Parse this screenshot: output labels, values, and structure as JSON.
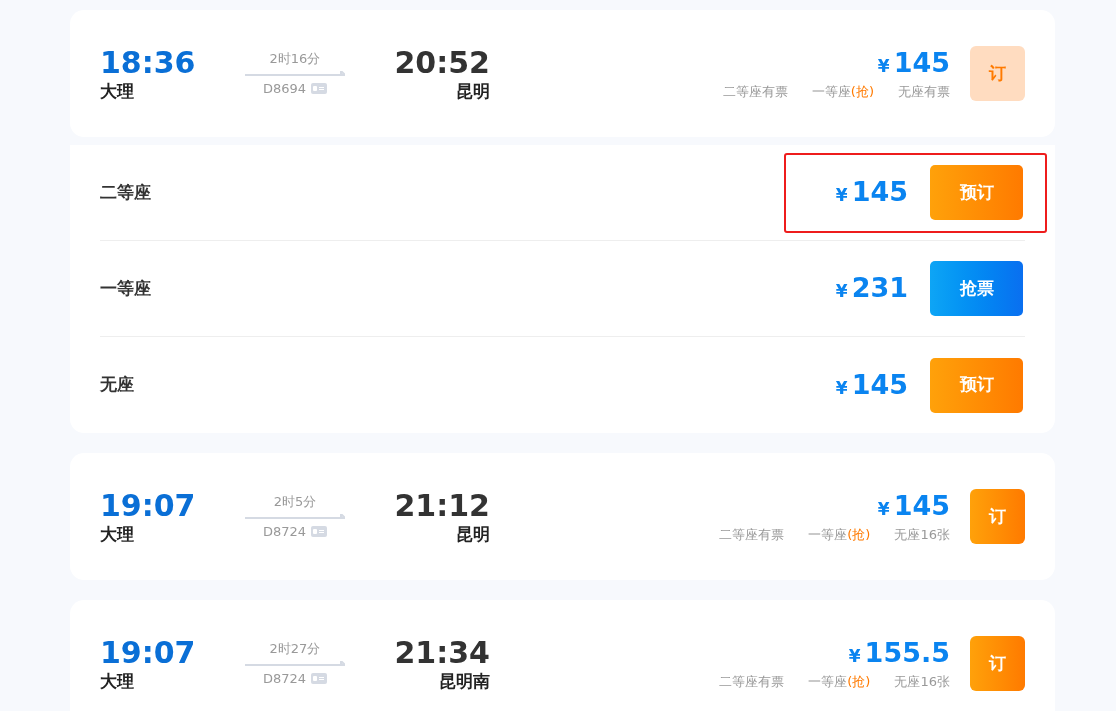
{
  "trains": [
    {
      "depart_time": "18:36",
      "depart_station": "大理",
      "duration": "2时16分",
      "train_no": "D8694",
      "arrive_time": "20:52",
      "arrive_station": "昆明",
      "price_symbol": "¥",
      "price": "145",
      "availability": [
        {
          "label": "二等座有票"
        },
        {
          "label": "一等座",
          "rush": "(抢)"
        },
        {
          "label": "无座有票"
        }
      ],
      "book_label": "订",
      "expanded": true,
      "seats": [
        {
          "name": "二等座",
          "price_symbol": "¥",
          "price": "145",
          "kind": "book",
          "button": "预订",
          "highlighted": true
        },
        {
          "name": "一等座",
          "price_symbol": "¥",
          "price": "231",
          "kind": "grab",
          "button": "抢票",
          "highlighted": false
        },
        {
          "name": "无座",
          "price_symbol": "¥",
          "price": "145",
          "kind": "book",
          "button": "预订",
          "highlighted": false
        }
      ]
    },
    {
      "depart_time": "19:07",
      "depart_station": "大理",
      "duration": "2时5分",
      "train_no": "D8724",
      "arrive_time": "21:12",
      "arrive_station": "昆明",
      "price_symbol": "¥",
      "price": "145",
      "availability": [
        {
          "label": "二等座有票"
        },
        {
          "label": "一等座",
          "rush": "(抢)"
        },
        {
          "label": "无座16张"
        }
      ],
      "book_label": "订",
      "expanded": false
    },
    {
      "depart_time": "19:07",
      "depart_station": "大理",
      "duration": "2时27分",
      "train_no": "D8724",
      "arrive_time": "21:34",
      "arrive_station": "昆明南",
      "price_symbol": "¥",
      "price": "155.5",
      "availability": [
        {
          "label": "二等座有票"
        },
        {
          "label": "一等座",
          "rush": "(抢)"
        },
        {
          "label": "无座16张"
        }
      ],
      "book_label": "订",
      "expanded": false
    }
  ]
}
